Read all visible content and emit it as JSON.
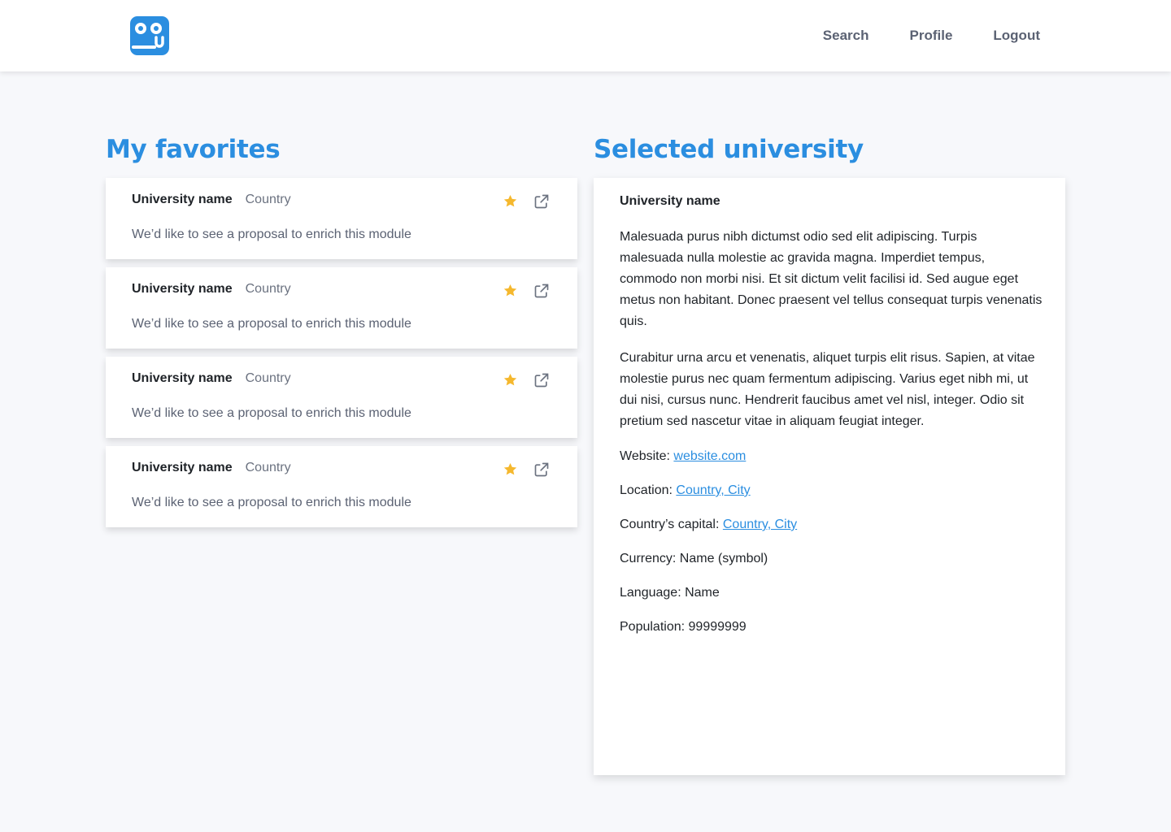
{
  "header": {
    "logo_icon": "brand-logo-icon",
    "nav": [
      {
        "label": "Search"
      },
      {
        "label": "Profile"
      },
      {
        "label": "Logout"
      }
    ]
  },
  "favorites": {
    "title": "My favorites",
    "items": [
      {
        "name": "University name",
        "country": "Country",
        "description": "We’d like to see a proposal to enrich this module"
      },
      {
        "name": "University name",
        "country": "Country",
        "description": "We’d like to see a proposal to enrich this module"
      },
      {
        "name": "University name",
        "country": "Country",
        "description": "We’d like to see a proposal to enrich this module"
      },
      {
        "name": "University name",
        "country": "Country",
        "description": "We’d like to see a proposal to enrich this module"
      }
    ]
  },
  "selected": {
    "title": "Selected university",
    "name": "University name",
    "paragraphs": [
      "Malesuada purus nibh dictumst odio sed elit adipiscing. Turpis malesuada nulla molestie ac gravida magna. Imperdiet tempus, commodo non morbi nisi. Et sit dictum velit facilisi id. Sed augue eget metus non habitant. Donec praesent vel tellus consequat turpis venenatis quis.",
      "Curabitur urna arcu et venenatis, aliquet turpis elit risus. Sapien, at vitae molestie purus nec quam fermentum adipiscing. Varius eget nibh mi, ut dui nisi, cursus nunc. Hendrerit faucibus amet vel nisl, integer. Odio sit pretium sed nascetur vitae in aliquam feugiat integer."
    ],
    "website": {
      "label": "Website:",
      "value": "website.com"
    },
    "location": {
      "label": "Location:",
      "value": "Country, City"
    },
    "capital": {
      "label": "Country’s capital:",
      "value": "Country, City"
    },
    "currency": {
      "label": "Currency:",
      "value": "Name (symbol)"
    },
    "language": {
      "label": "Language:",
      "value": "Name"
    },
    "population": {
      "label": "Population:",
      "value": "99999999"
    }
  },
  "colors": {
    "accent": "#2b8ee0",
    "star": "#f5b82e",
    "background": "#f7f8fb"
  },
  "icons": {
    "favorite": "star-icon",
    "open": "external-link-icon"
  }
}
